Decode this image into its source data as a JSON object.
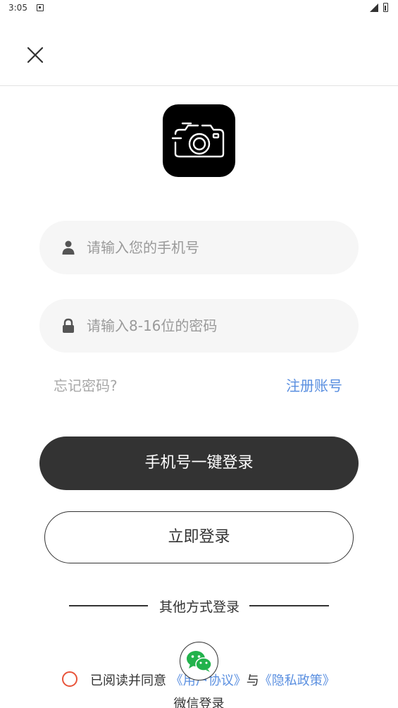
{
  "status_bar": {
    "time": "3:05"
  },
  "header": {
    "close_icon": "close-icon"
  },
  "logo": {
    "icon": "camera-icon",
    "background": "#000000"
  },
  "form": {
    "phone_placeholder": "请输入您的手机号",
    "phone_icon": "user-icon",
    "password_placeholder": "请输入8-16位的密码",
    "password_icon": "lock-icon",
    "forgot_label": "忘记密码?",
    "register_label": "注册账号"
  },
  "buttons": {
    "oneclick_label": "手机号一键登录",
    "login_label": "立即登录"
  },
  "other_login": {
    "title": "其他方式登录",
    "wechat_label": "微信登录",
    "wechat_icon": "wechat-icon"
  },
  "agreement": {
    "prefix": "已阅读并同意",
    "user_agreement": "《用户协议》",
    "conjunction": "与",
    "privacy_policy": "《隐私政策》"
  },
  "colors": {
    "primary_button": "#333333",
    "link": "#5a8fe0",
    "checkbox_border": "#e8543a",
    "input_background": "#f6f6f6"
  }
}
